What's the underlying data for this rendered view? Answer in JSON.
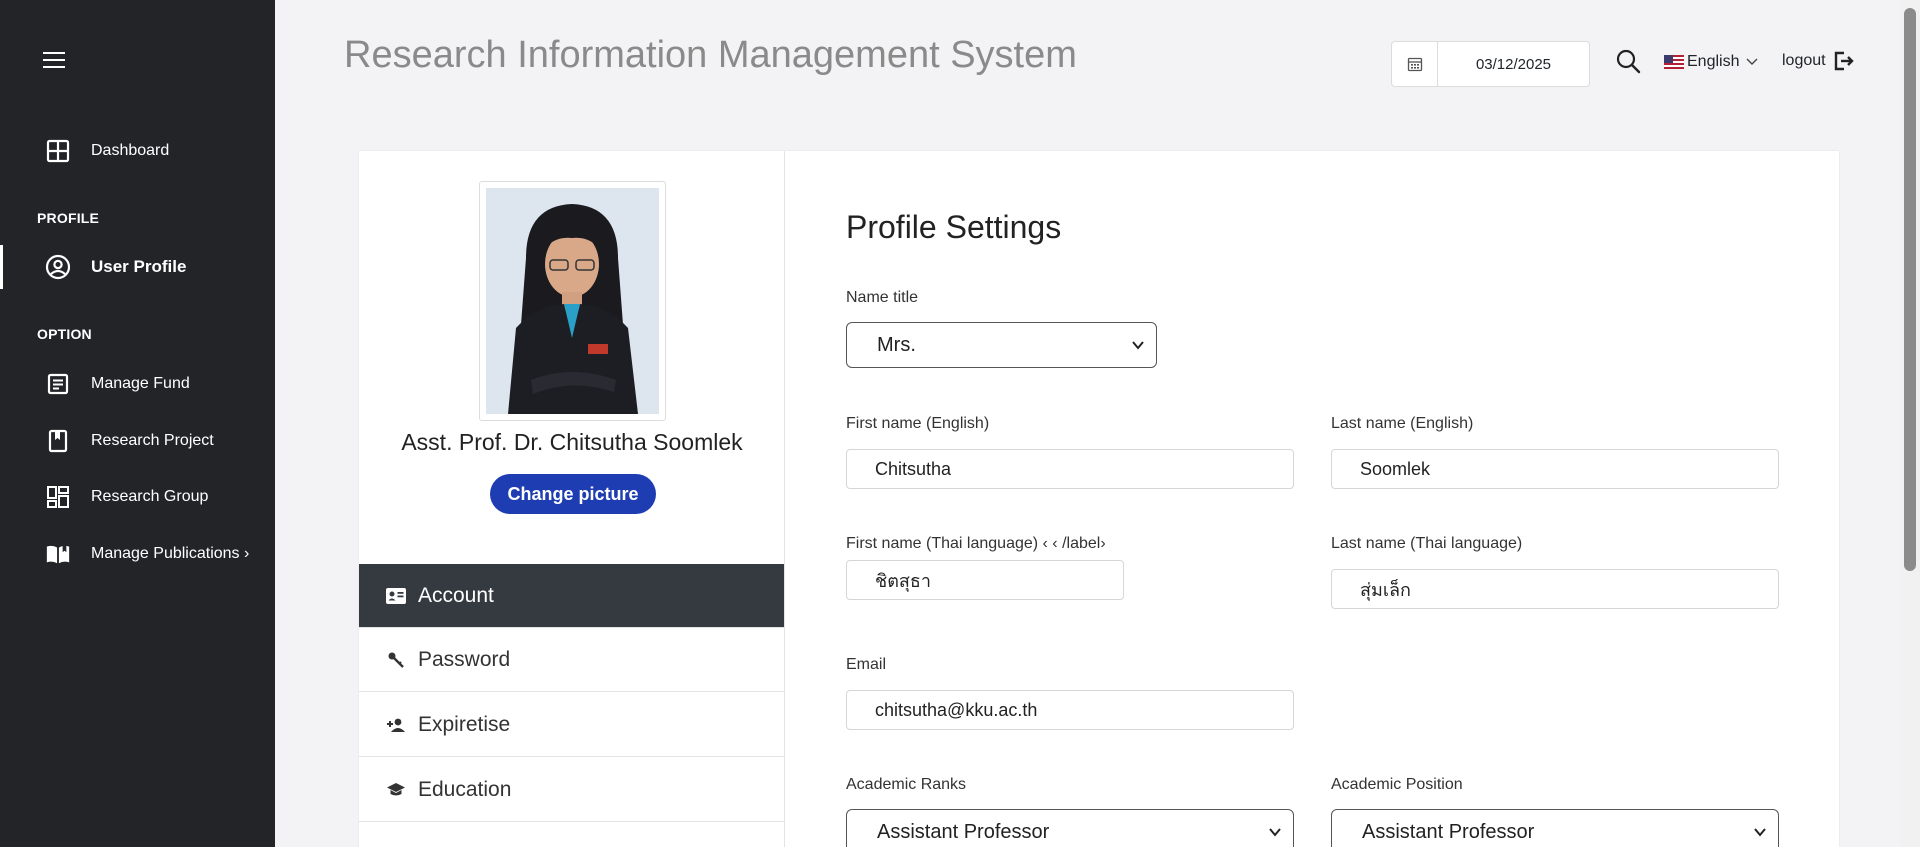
{
  "app": {
    "title": "Research Information Management System"
  },
  "sidebar": {
    "profile_section": "PROFILE",
    "option_section": "OPTION",
    "items": [
      {
        "label": "Dashboard",
        "icon": "dashboard-icon"
      },
      {
        "label": "User Profile",
        "icon": "user-circle-icon"
      },
      {
        "label": "Manage Fund",
        "icon": "document-icon"
      },
      {
        "label": "Research Project",
        "icon": "bookmark-icon"
      },
      {
        "label": "Research Group",
        "icon": "grid-icon"
      },
      {
        "label": "Manage Publications ›",
        "icon": "open-book-icon"
      }
    ]
  },
  "header": {
    "date": "03/12/2025",
    "language": "English",
    "logout": "logout"
  },
  "profile": {
    "name": "Asst. Prof. Dr. Chitsutha Soomlek",
    "change_picture": "Change picture",
    "tabs": [
      {
        "label": "Account",
        "icon": "id-card-icon"
      },
      {
        "label": "Password",
        "icon": "key-icon"
      },
      {
        "label": "Expiretise",
        "icon": "person-add-icon"
      },
      {
        "label": "Education",
        "icon": "graduation-cap-icon"
      }
    ]
  },
  "form": {
    "title": "Profile Settings",
    "name_title_label": "Name title",
    "name_title_value": "Mrs.",
    "first_name_en_label": "First name (English)",
    "first_name_en_value": "Chitsutha",
    "last_name_en_label": "Last name (English)",
    "last_name_en_value": "Soomlek",
    "first_name_th_label": "First name (Thai language) ‹ ‹ /label›",
    "first_name_th_value": "ชิตสุธา",
    "last_name_th_label": "Last name (Thai language)",
    "last_name_th_value": "สุ่มเล็ก",
    "email_label": "Email",
    "email_value": "chitsutha@kku.ac.th",
    "academic_ranks_label": "Academic Ranks",
    "academic_ranks_value": "Assistant Professor",
    "academic_position_label": "Academic Position",
    "academic_position_value": "Assistant Professor"
  },
  "colors": {
    "sidebar_bg": "#222428",
    "accent_button": "#1f3db3",
    "active_tab_bg": "#343a40"
  }
}
